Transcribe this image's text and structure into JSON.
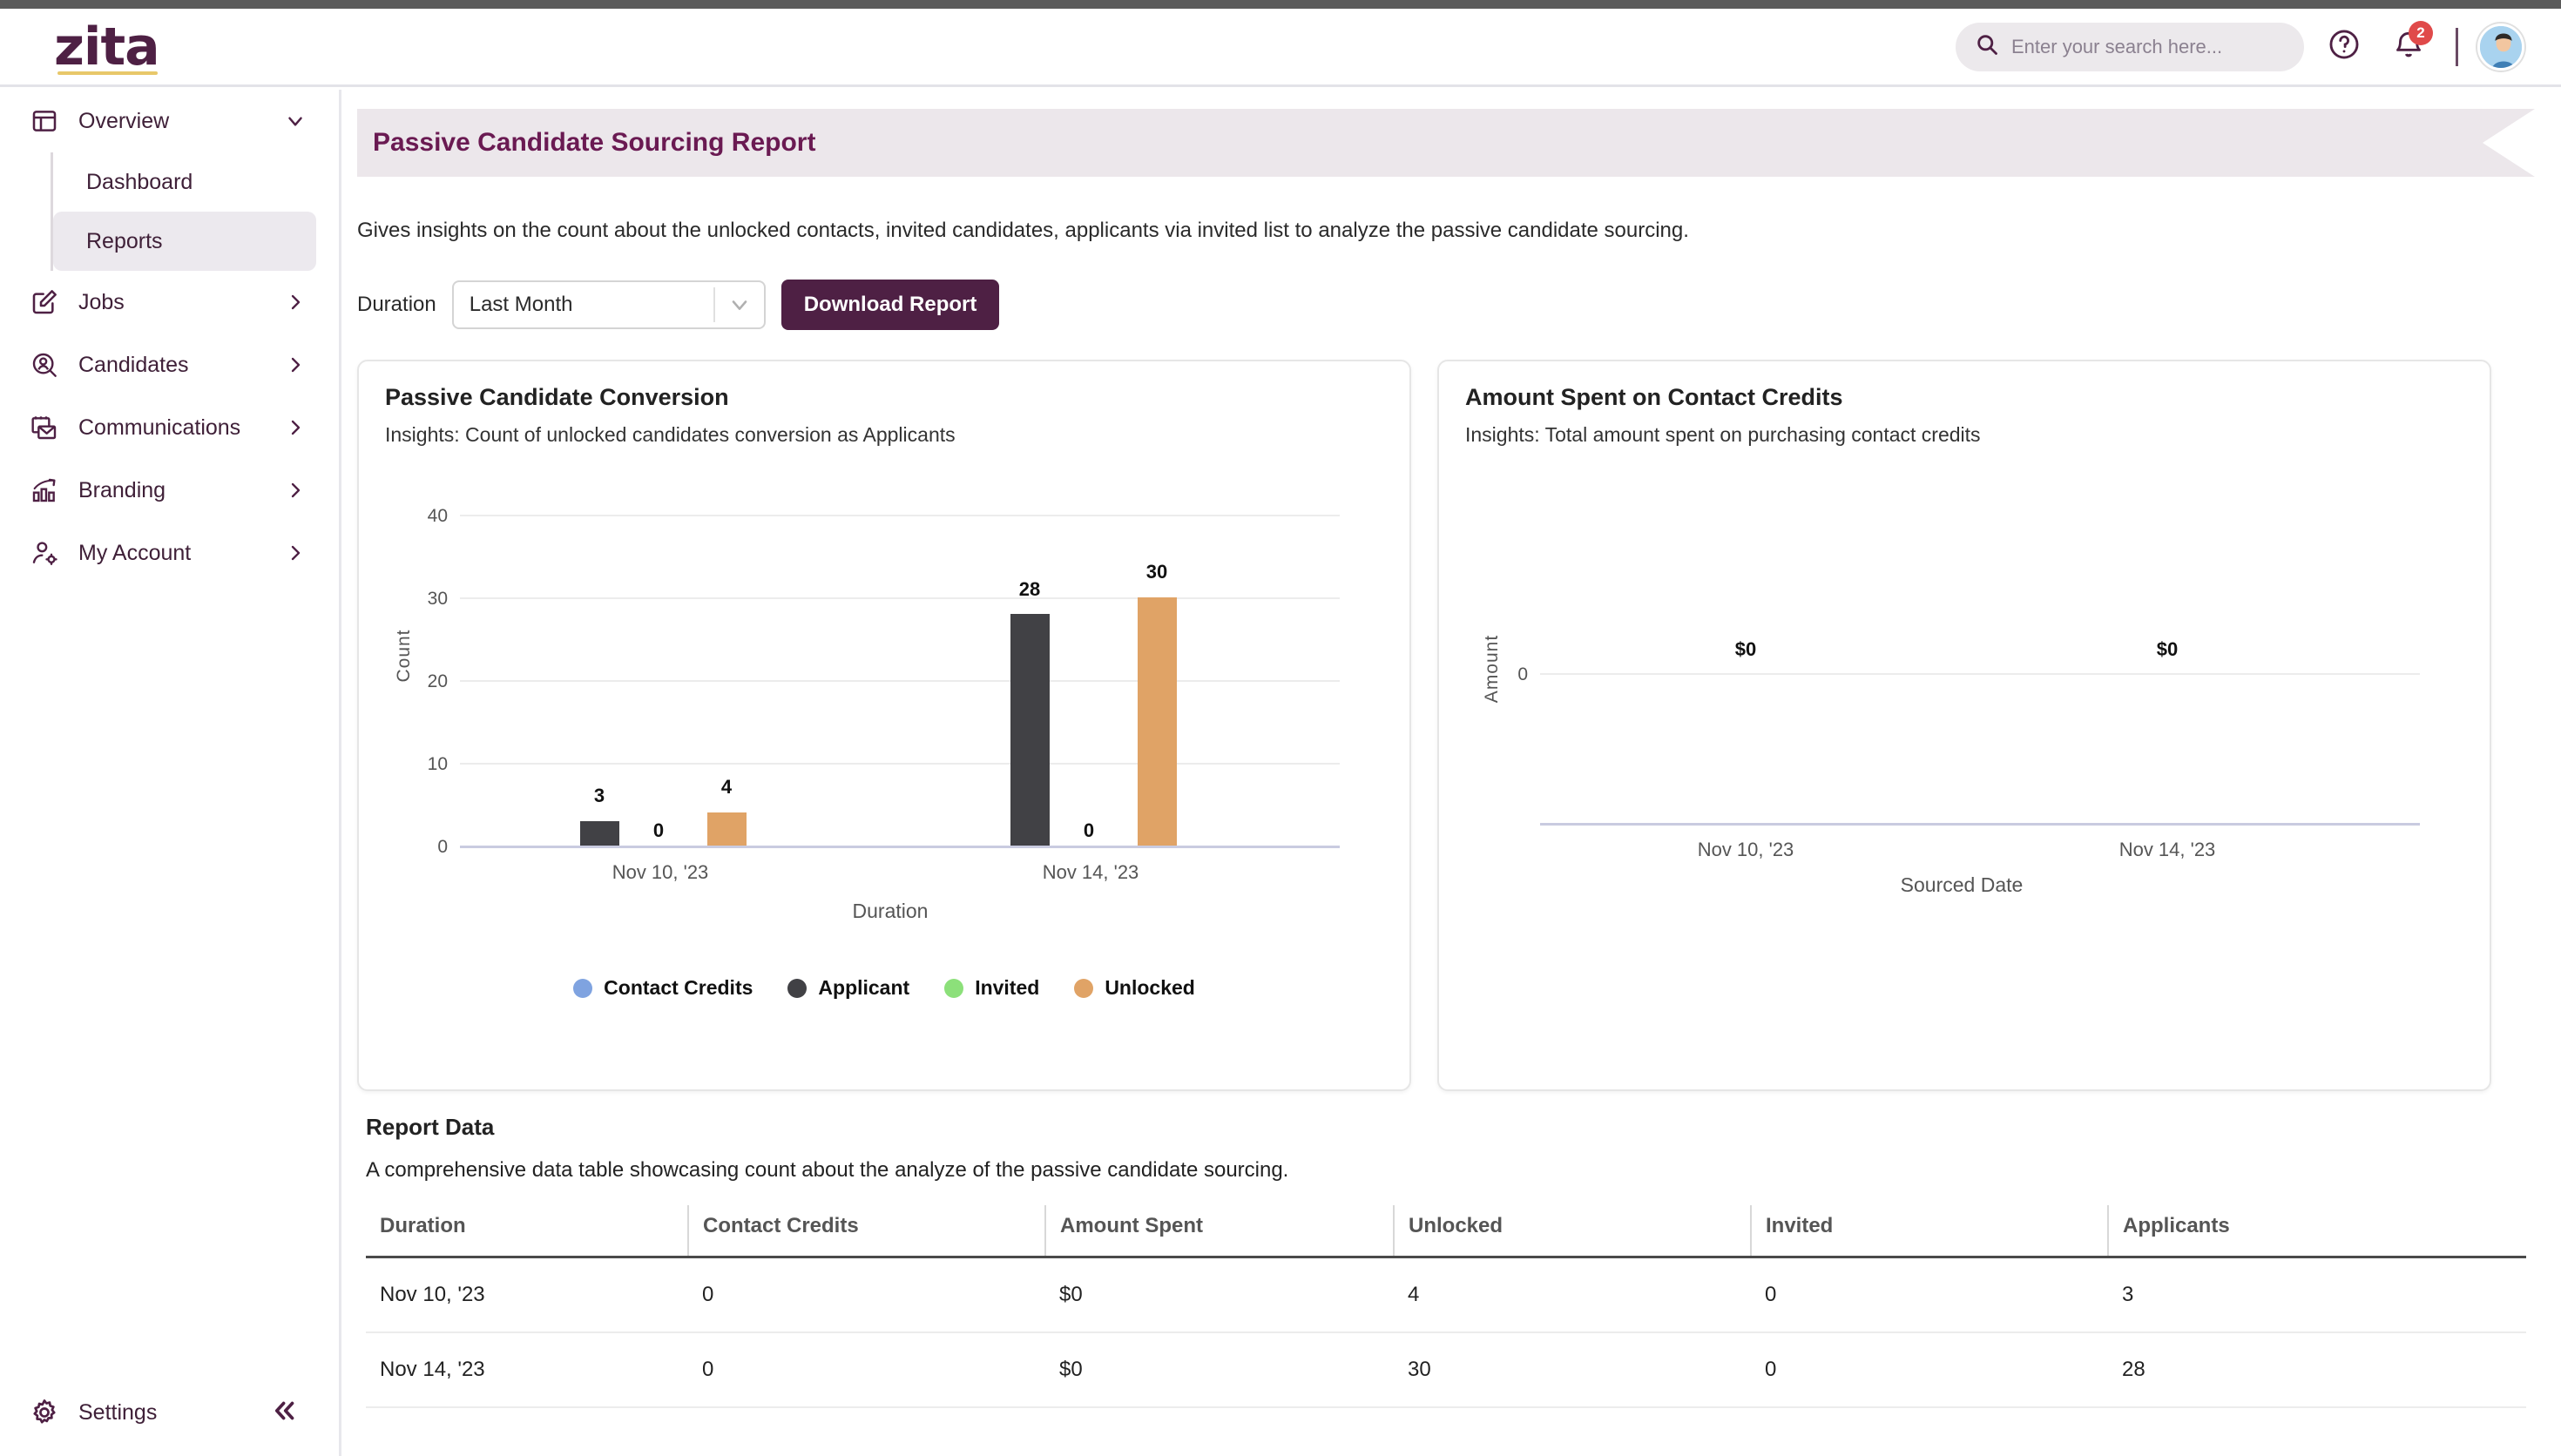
{
  "brand": {
    "logo_text": "zita",
    "accent": "#4e2044",
    "underline": "#e8c86a"
  },
  "topbar": {
    "search": {
      "placeholder": "Enter your search here...",
      "value": "",
      "icon": "search-icon"
    },
    "help_icon": "help-circle-icon",
    "notification": {
      "icon": "bell-icon",
      "count": "2",
      "badge_color": "#e04a4a"
    },
    "avatar_icon": "user-avatar"
  },
  "sidebar": {
    "items": [
      {
        "label": "Overview",
        "icon": "layout-dashboard-icon",
        "chevron": "chevron-down-icon",
        "expanded": true
      },
      {
        "label": "Jobs",
        "icon": "edit-square-icon",
        "chevron": "chevron-right-icon",
        "expanded": false
      },
      {
        "label": "Candidates",
        "icon": "user-search-icon",
        "chevron": "chevron-right-icon",
        "expanded": false
      },
      {
        "label": "Communications",
        "icon": "mail-calendar-icon",
        "chevron": "chevron-right-icon",
        "expanded": false
      },
      {
        "label": "Branding",
        "icon": "bar-chart-growth-icon",
        "chevron": "chevron-right-icon",
        "expanded": false
      },
      {
        "label": "My Account",
        "icon": "user-gear-icon",
        "chevron": "chevron-right-icon",
        "expanded": false
      }
    ],
    "subitems": [
      {
        "label": "Dashboard",
        "active": false
      },
      {
        "label": "Reports",
        "active": true
      }
    ],
    "settings": {
      "label": "Settings",
      "icon": "gear-icon"
    },
    "collapse": {
      "icon": "chevrons-left-icon"
    }
  },
  "page": {
    "title": "Passive Candidate Sourcing Report",
    "description": "Gives insights on the count about the unlocked contacts, invited candidates, applicants via invited list to analyze the passive candidate sourcing.",
    "duration_label": "Duration",
    "duration_value": "Last Month",
    "duration_arrow_icon": "chevron-down-icon",
    "download_label": "Download Report"
  },
  "cards": {
    "left": {
      "title": "Passive Candidate Conversion",
      "subtitle": "Insights: Count of unlocked candidates conversion as Applicants"
    },
    "right": {
      "title": "Amount Spent on Contact Credits",
      "subtitle": "Insights: Total amount spent on purchasing contact credits"
    }
  },
  "report": {
    "title": "Report Data",
    "description": "A comprehensive data table showcasing count about the analyze of the passive candidate sourcing.",
    "columns": [
      "Duration",
      "Contact Credits",
      "Amount Spent",
      "Unlocked",
      "Invited",
      "Applicants"
    ],
    "rows": [
      [
        "Nov 10, '23",
        "0",
        "$0",
        "4",
        "0",
        "3"
      ],
      [
        "Nov 14, '23",
        "0",
        "$0",
        "30",
        "0",
        "28"
      ]
    ]
  },
  "chart_data": [
    {
      "type": "bar",
      "title": "Passive Candidate Conversion",
      "subtitle": "Insights: Count of unlocked candidates conversion as Applicants",
      "xlabel": "Duration",
      "ylabel": "Count",
      "categories": [
        "Nov 10, '23",
        "Nov 14, '23"
      ],
      "yticks": [
        0,
        10,
        20,
        30,
        40
      ],
      "ylim": [
        0,
        40
      ],
      "grid": true,
      "legend_position": "bottom",
      "data_labels": true,
      "series": [
        {
          "name": "Contact Credits",
          "color": "#7fa3e0",
          "values": [
            0,
            0
          ],
          "labels": [
            "",
            ""
          ],
          "rendered": false
        },
        {
          "name": "Applicant",
          "color": "#414145",
          "values": [
            3,
            28
          ],
          "labels": [
            "3",
            "28"
          ],
          "rendered": true
        },
        {
          "name": "Invited",
          "color": "#8ce07a",
          "values": [
            0,
            0
          ],
          "labels": [
            "0",
            "0"
          ],
          "rendered": true
        },
        {
          "name": "Unlocked",
          "color": "#e0a366",
          "values": [
            4,
            30
          ],
          "labels": [
            "4",
            "30"
          ],
          "rendered": true
        }
      ]
    },
    {
      "type": "bar",
      "title": "Amount Spent on Contact Credits",
      "subtitle": "Insights: Total amount spent on purchasing contact credits",
      "xlabel": "Sourced Date",
      "ylabel": "Amount",
      "categories": [
        "Nov 10, '23",
        "Nov 14, '23"
      ],
      "yticks": [
        0
      ],
      "ylim": [
        0,
        0
      ],
      "grid": true,
      "legend_position": "none",
      "data_labels": true,
      "series": [
        {
          "name": "Amount Spent",
          "color": "#7fa3e0",
          "values": [
            0,
            0
          ],
          "labels": [
            "$0",
            "$0"
          ],
          "rendered": true
        }
      ]
    }
  ]
}
